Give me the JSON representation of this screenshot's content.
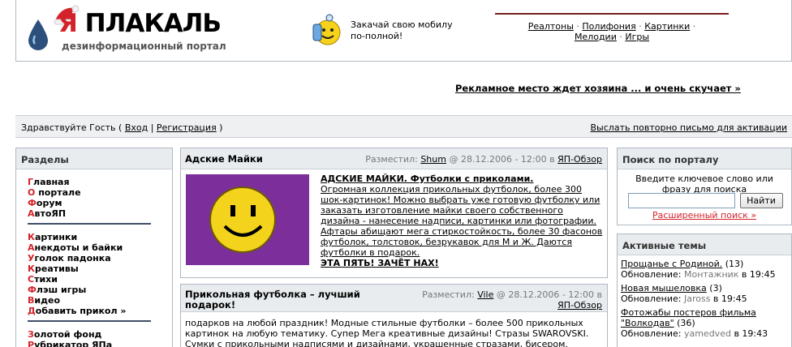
{
  "header": {
    "logo": {
      "word_accent": "Я",
      "word_rest": " ПЛАКАЛЬ",
      "tagline": "дезинформационный портал"
    },
    "promo": {
      "line1": "Закачай свою мобилу",
      "line2": "по-полной!"
    },
    "nav": {
      "items": [
        "Реалтоны",
        "Полифония",
        "Картинки",
        "Мелодии",
        "Игры"
      ],
      "separator": "·"
    }
  },
  "ad": {
    "text": "Рекламное место ждет хозяина ... и очень скучает »"
  },
  "greeting": {
    "prefix": "Здравствуйте Гость (",
    "login": "Вход",
    "divider": " | ",
    "register": "Регистрация",
    "suffix": " )",
    "resend": "Выслать повторно письмо для активации"
  },
  "sidebar": {
    "title": "Разделы",
    "groups": [
      [
        {
          "first": "Г",
          "rest": "лавная"
        },
        {
          "first": "О",
          "rest": " портале"
        },
        {
          "first": "Ф",
          "rest": "орум"
        },
        {
          "first": "А",
          "rest": "втоЯП"
        }
      ],
      [
        {
          "first": "К",
          "rest": "артинки"
        },
        {
          "first": "А",
          "rest": "некдоты и байки"
        },
        {
          "first": "У",
          "rest": "голок падонка"
        },
        {
          "first": "К",
          "rest": "реативы"
        },
        {
          "first": "С",
          "rest": "тихи"
        },
        {
          "first": "Ф",
          "rest": "лэш игры"
        },
        {
          "first": "В",
          "rest": "идео"
        },
        {
          "first": "Д",
          "rest": "обавить прикол »"
        }
      ],
      [
        {
          "first": "З",
          "rest": "олотой фонд"
        },
        {
          "first": "Р",
          "rest": "убрикатор ЯПа"
        }
      ]
    ]
  },
  "posts": [
    {
      "title": "Адские Майки",
      "meta_prefix": "Разместил: ",
      "author": "Shum",
      "meta_date": " @ 28.12.2006 - 12:00 в ",
      "section": "ЯП-Обзор",
      "headline": "АДСКИЕ МАЙКИ. Футболки с приколами.",
      "body": "Огромная коллекция прикольных футболок, более 300 шок-картинок! Можно выбрать уже готовую футболку или заказать изготовление майки своего собственного дизайна - нанесение надписи, картинки или фотографии. Афтары абищают мега стиркостойкость, более 30 фасонов футболок, толстовок, безрукавок для М и Ж. Даются футболки в подарок.",
      "footer": "ЭТА ПЯТЬ! ЗАЧЁТ НАХ!"
    },
    {
      "title": "Прикольная футболка – лучший подарок!",
      "meta_prefix": "Разместил: ",
      "author": "Vile",
      "meta_date": " @ 28.12.2006 - 12:00 в ",
      "section": "ЯП-Обзор",
      "body": "подарков на любой праздник! Модные стильные футболки – более 500 прикольных картинок на любую тематику. Супер Мега креативные дизайны! Стразы SWAROVSKI. Сумки с прикольными надписями и дизайнами, украшенные стразами, бисером."
    }
  ],
  "search": {
    "title": "Поиск по порталу",
    "hint": "Введите ключевое слово или фразу для поиска",
    "input_value": "",
    "button": "Найти",
    "advanced": "Расширенный поиск »"
  },
  "topics": {
    "title": "Активные темы",
    "items": [
      {
        "title": "Прощанье с Родиной.",
        "count": " (13)",
        "updated": "Обновление: ",
        "who": "Монтажник",
        "time": " в 19:45"
      },
      {
        "title": "Новая мышеловка",
        "count": " (3)",
        "updated": "Обновление: ",
        "who": "Jaross",
        "time": " в 19:45"
      },
      {
        "title": "Фотожабы постеров фильма \"Волкодав\"",
        "count": " (36)",
        "updated": "Обновление: ",
        "who": "yamedved",
        "time": " в 19:43"
      }
    ]
  },
  "colors": {
    "accent_red": "#d3232a",
    "panel_bg": "#e9ecef",
    "border": "#b0b8c2",
    "smiley_bg": "#7c2f9b"
  }
}
